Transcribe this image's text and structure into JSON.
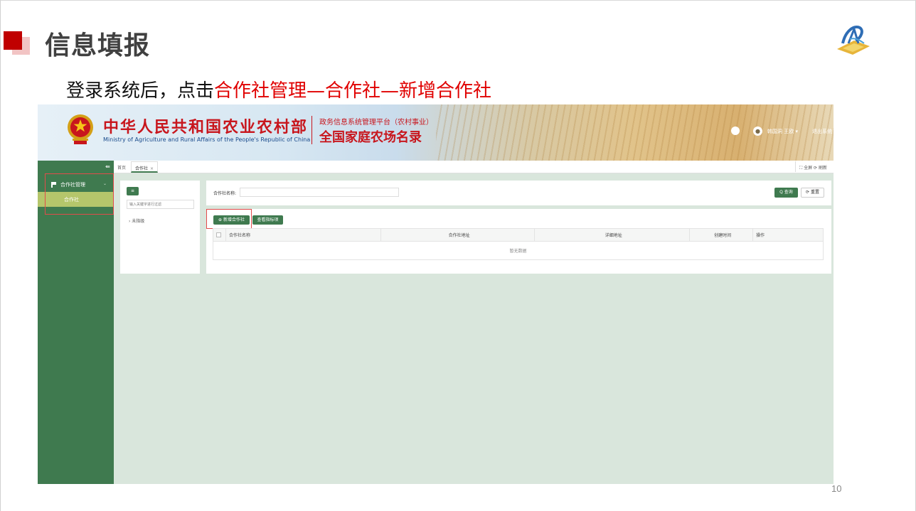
{
  "slide": {
    "title": "信息填报",
    "instruction_prefix": "登录系统后，点击",
    "instruction_highlight": "合作社管理—合作社—新增合作社",
    "page_number": "10"
  },
  "colors": {
    "accent_red": "#c00000",
    "highlight_red": "#e00000",
    "brand_green": "#3f7a4f",
    "menu_active": "#b5c66b",
    "content_bg": "#d9e6dc"
  },
  "app": {
    "header": {
      "ministry_cn": "中华人民共和国农业农村部",
      "ministry_en": "Ministry of Agriculture and Rural Affairs of the People's Republic of China",
      "platform_sub": "政务信息系统管理平台（农村事业）",
      "platform_name": "全国家庭农场名录",
      "user_label": "韩国洞 王欧 ▾",
      "logout_label": "退出系统"
    },
    "sidebar": {
      "collapse_icon": "collapse-icon",
      "parent_label": "合作社管理",
      "parent_chevron": "⌄",
      "child_label": "合作社"
    },
    "tabs": {
      "home": "首页",
      "active": "合作社",
      "close": "×",
      "tools": "⛶ 全屏 ⟳ 刷新"
    },
    "tree": {
      "add_button": "≡",
      "filter_placeholder": "输入关键字进行过滤",
      "root_node": "› 未指级"
    },
    "search": {
      "label": "合作社名称:",
      "value": "",
      "query_button": "Q 查询",
      "reset_button": "⟳ 重置"
    },
    "table": {
      "add_button": "⊕ 新增合作社",
      "view_button": "查看指标项",
      "columns": [
        "合作社名称",
        "合作社地址",
        "详细地址",
        "创建时间",
        "操作"
      ],
      "empty_text": "暂无数据"
    }
  }
}
